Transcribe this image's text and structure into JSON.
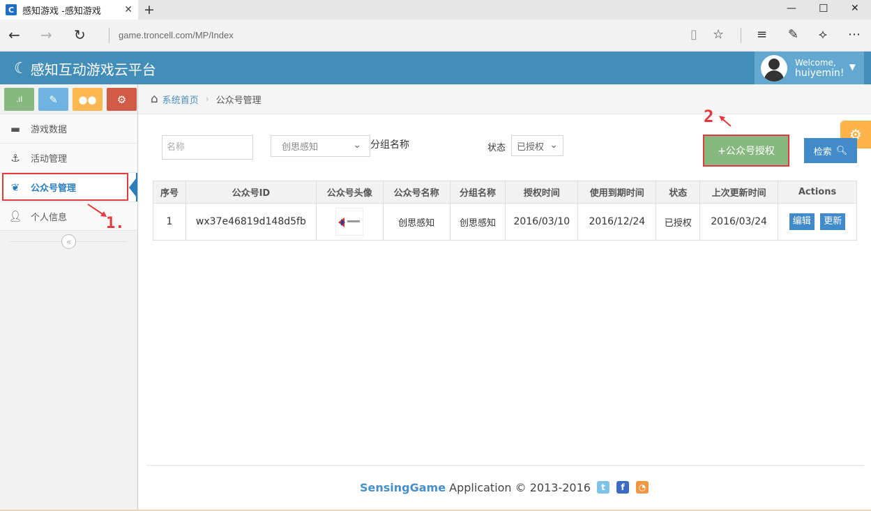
{
  "browser": {
    "tab_title": "感知游戏 -感知游戏",
    "url": "game.troncell.com/MP/Index"
  },
  "header": {
    "brand": "感知互动游戏云平台",
    "welcome": "Welcome,",
    "username": "huiyemin!"
  },
  "sidebar": {
    "items": [
      {
        "label": "游戏数据",
        "icon": "archive-icon"
      },
      {
        "label": "活动管理",
        "icon": "anchor-icon"
      },
      {
        "label": "公众号管理",
        "icon": "wechat-icon",
        "active": true
      },
      {
        "label": "个人信息",
        "icon": "user-icon"
      }
    ]
  },
  "breadcrumb": {
    "home": "系统首页",
    "current": "公众号管理"
  },
  "filters": {
    "name_placeholder": "名称",
    "group_value": "创思感知",
    "group_label": "分组名称",
    "status_label": "状态",
    "status_value": "已授权"
  },
  "buttons": {
    "authorize": "+公众号授权",
    "search": "检索"
  },
  "annotations": {
    "one": "1.",
    "two": "2"
  },
  "table": {
    "headers": [
      "序号",
      "公众号ID",
      "公众号头像",
      "公众号名称",
      "分组名称",
      "授权时间",
      "使用到期时间",
      "状态",
      "上次更新时间",
      "Actions"
    ],
    "rows": [
      {
        "index": "1",
        "mp_id": "wx37e46819d148d5fb",
        "name": "创思感知",
        "group": "创思感知",
        "auth_time": "2016/03/10",
        "expire_time": "2016/12/24",
        "status": "已授权",
        "updated": "2016/03/24",
        "edit": "编辑",
        "refresh": "更新"
      }
    ]
  },
  "footer": {
    "brand": "SensingGame",
    "text": " Application © 2013-2016"
  },
  "colors": {
    "header_bg": "#438eb9",
    "user_box_bg": "#62a8d1",
    "authorize_btn": "#87b87f",
    "search_btn": "#428bca",
    "annotation_red": "#e4393c",
    "settings_tab": "#ffb44b"
  }
}
